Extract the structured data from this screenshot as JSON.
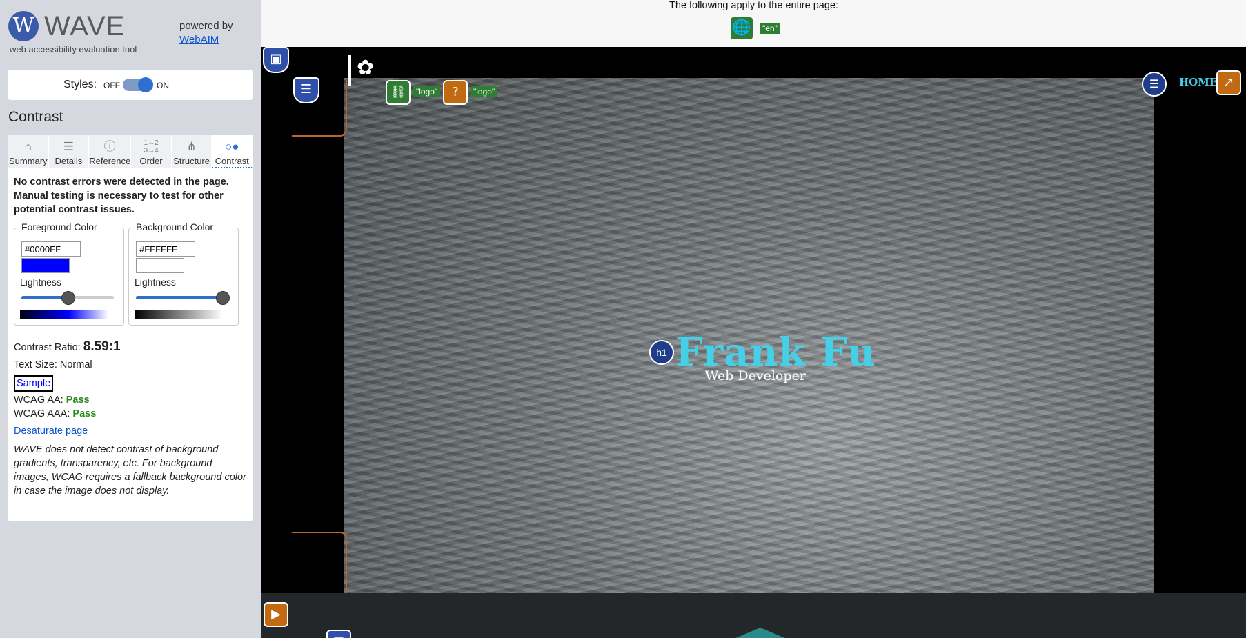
{
  "sidebar": {
    "brand": {
      "logo_letter": "W",
      "name": "WAVE",
      "tagline": "web accessibility evaluation tool",
      "powered_by": "powered by",
      "webaim": "WebAIM"
    },
    "styles": {
      "label": "Styles:",
      "off": "OFF",
      "on": "ON",
      "state": "on"
    },
    "panel_title": "Contrast",
    "tabs": [
      {
        "label": "Summary",
        "icon": "home-icon"
      },
      {
        "label": "Details",
        "icon": "list-icon"
      },
      {
        "label": "Reference",
        "icon": "info-icon"
      },
      {
        "label": "Order",
        "icon": "order-icon"
      },
      {
        "label": "Structure",
        "icon": "structure-icon"
      },
      {
        "label": "Contrast",
        "icon": "contrast-icon",
        "active": true
      }
    ],
    "contrast": {
      "message": "No contrast errors were detected in the page. Manual testing is necessary to test for other potential contrast issues.",
      "foreground": {
        "legend": "Foreground Color",
        "hex": "#0000FF",
        "lightness_label": "Lightness",
        "lightness": 0.5
      },
      "background": {
        "legend": "Background Color",
        "hex": "#FFFFFF",
        "lightness_label": "Lightness",
        "lightness": 1.0
      },
      "ratio_label": "Contrast Ratio:",
      "ratio_value": "8.59:1",
      "text_size": "Text Size: Normal",
      "sample": "Sample",
      "aa_label": "WCAG AA:",
      "aa_value": "Pass",
      "aaa_label": "WCAG AAA:",
      "aaa_value": "Pass",
      "desaturate": "Desaturate page",
      "note": "WAVE does not detect contrast of background gradients, transparency, etc. For background images, WCAG requires a fallback background color in case the image does not display."
    }
  },
  "page": {
    "lang_text": "The following apply to the entire page:",
    "lang_tag": "\"en\"",
    "alt_tag_1": "\"logo\"",
    "alt_tag_2": "\"logo\"",
    "h1_badge": "h1",
    "hero_name": "Frank Fu",
    "hero_sub": "Web Developer",
    "nav_home": "HOME"
  },
  "colors": {
    "accent": "#2f6fd0",
    "pass": "#2b8a1d",
    "heading": "#46d0e8",
    "wave_green": "#2e7d32",
    "wave_orange": "#c26a12"
  }
}
